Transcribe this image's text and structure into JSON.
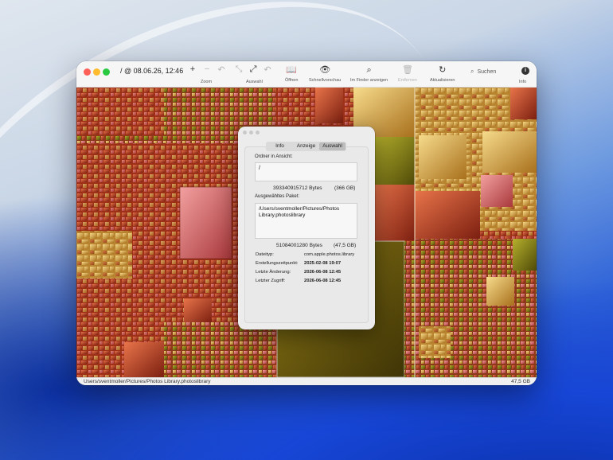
{
  "window": {
    "title": "/ @ 08.06.26, 12:46"
  },
  "toolbar": {
    "zoom_label": "Zoom",
    "selection_label": "Auswahl",
    "open_label": "Öffnen",
    "quicklook_label": "Schnellvorschau",
    "finder_label": "Im Finder anzeigen",
    "remove_label": "Entfernen",
    "refresh_label": "Aktualisieren",
    "search_placeholder": "Suchen",
    "info_label": "Info",
    "icons": [
      "zoom-in-icon",
      "zoom-out-icon",
      "undo-icon",
      "shrink-icon",
      "expand-icon",
      "undo-selection-icon",
      "book-icon",
      "eye-icon",
      "finder-icon",
      "trash-icon",
      "refresh-icon",
      "search-icon",
      "info-icon"
    ]
  },
  "inspector": {
    "tabs": [
      "Info",
      "Anzeige",
      "Auswahl"
    ],
    "active_tab": "Auswahl",
    "folder_label": "Ordner in Ansicht:",
    "folder_path": "/",
    "folder_bytes": "393340915712 Bytes",
    "folder_size": "(366 GB)",
    "package_label": "Ausgewähltes Paket:",
    "package_path": "/Users/sventmoller/Pictures/Photos Library.photoslibrary",
    "package_bytes": "51084001280 Bytes",
    "package_size": "(47,5 GB)",
    "meta": [
      {
        "key": "Dateityp:",
        "value": "com.apple.photos.library"
      },
      {
        "key": "Erstellungszeitpunkt:",
        "value": "2025-02-08 19:07"
      },
      {
        "key": "Letzte Änderung:",
        "value": "2026-06-08 12:45"
      },
      {
        "key": "Letzter Zugriff:",
        "value": "2026-06-08 12:45"
      }
    ]
  },
  "statusbar": {
    "path": "Users/sventmoller/Pictures/Photos Library.photoslibrary",
    "size": "47,5 GB"
  },
  "colors": {
    "treemap_red": "#b8331e",
    "treemap_gold": "#d9a842",
    "treemap_olive": "#6b5a0c",
    "treemap_pink": "#d96a6a"
  }
}
